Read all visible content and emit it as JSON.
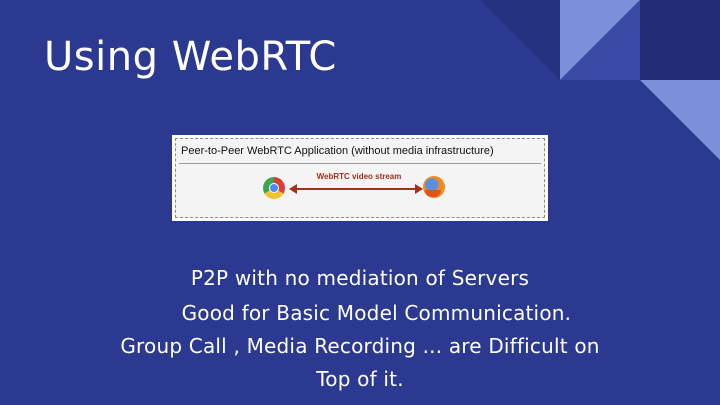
{
  "slide": {
    "title": "Using WebRTC",
    "figure": {
      "title": "Peer-to-Peer WebRTC Application (without media infrastructure)",
      "stream_label": "WebRTC video stream",
      "left_icon": "chrome-icon",
      "right_icon": "firefox-icon"
    },
    "body_lines": [
      "P2P with no mediation of Servers",
      "     Good for Basic Model Communication.",
      "Group Call , Media Recording ... are Difficult on",
      "Top of it."
    ]
  },
  "colors": {
    "background": "#2b3990",
    "accent_light": "#7a8fd6",
    "accent_dark": "#1f2a70",
    "arrow": "#a1301f"
  }
}
